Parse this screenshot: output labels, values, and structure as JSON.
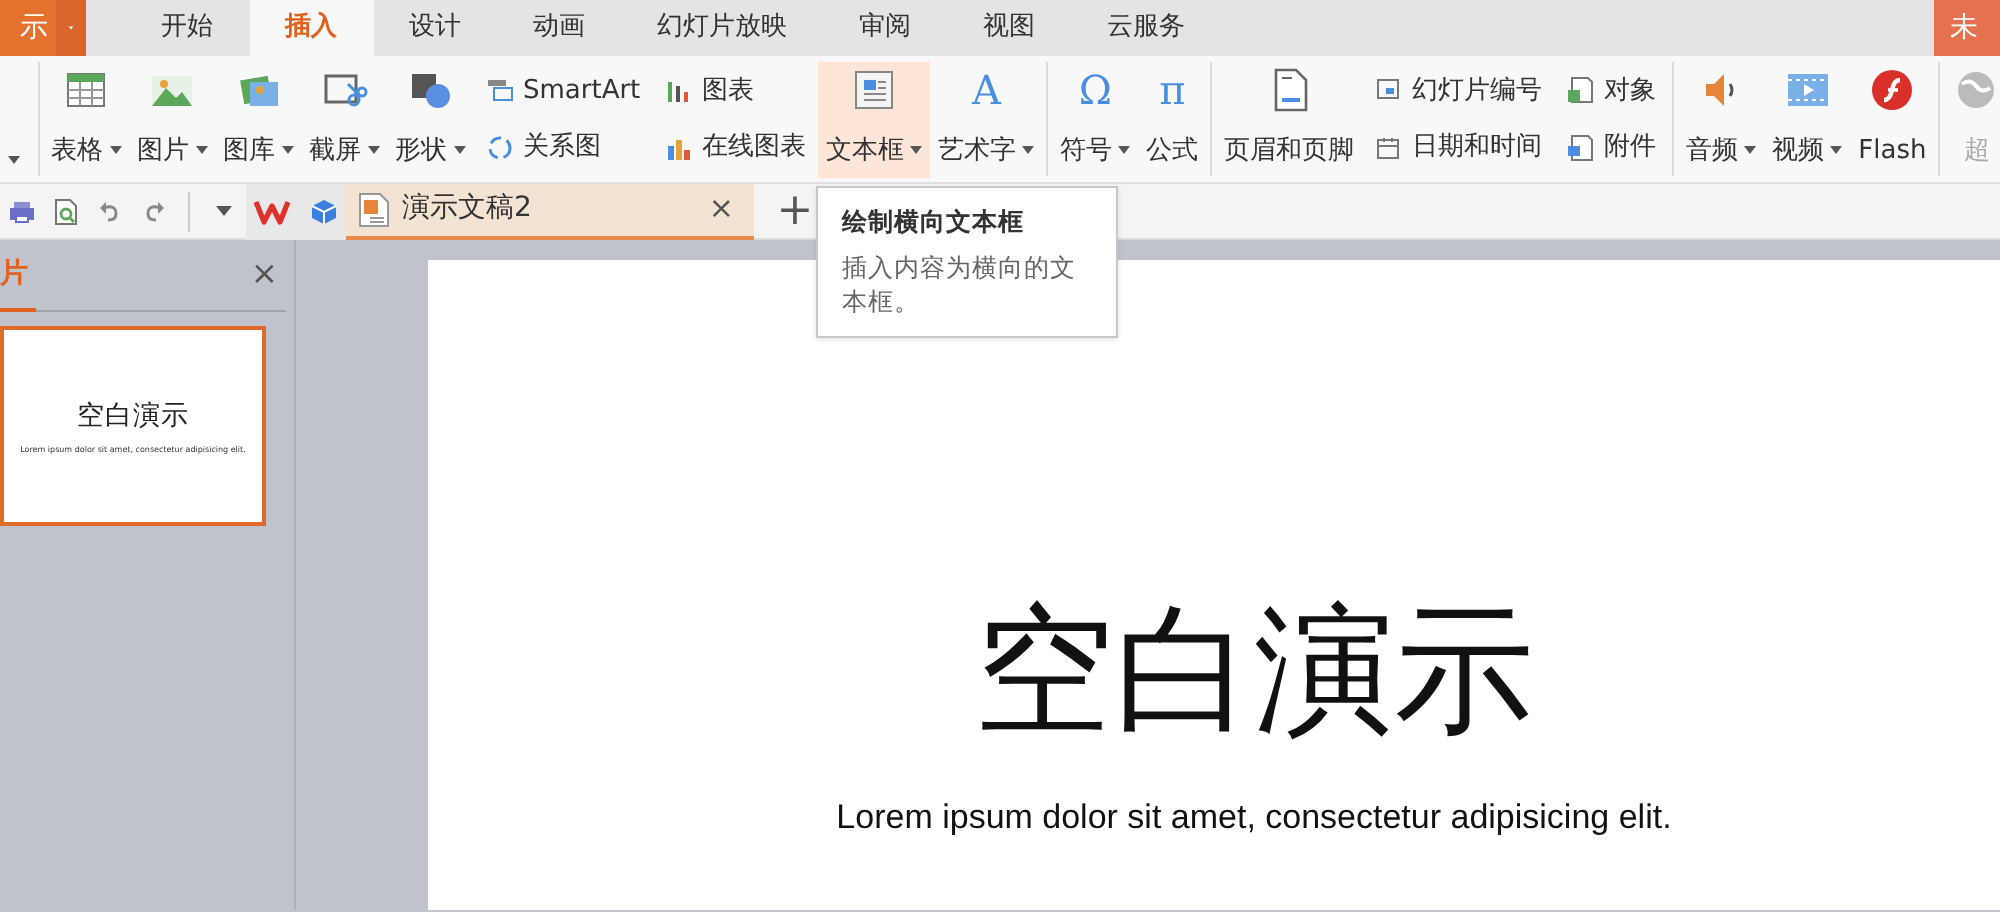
{
  "app_button": {
    "label": "示"
  },
  "menu_tabs": [
    {
      "label": "开始",
      "selected": false
    },
    {
      "label": "插入",
      "selected": true
    },
    {
      "label": "设计",
      "selected": false
    },
    {
      "label": "动画",
      "selected": false
    },
    {
      "label": "幻灯片放映",
      "selected": false
    },
    {
      "label": "审阅",
      "selected": false
    },
    {
      "label": "视图",
      "selected": false
    },
    {
      "label": "云服务",
      "selected": false
    }
  ],
  "corner_button": {
    "label": "未"
  },
  "ribbon_groups": [
    {
      "items": [
        {
          "kind": "large",
          "label": "表格",
          "dropdown": true,
          "highlighted": false,
          "disabled": false
        },
        {
          "kind": "large",
          "label": "图片",
          "dropdown": true,
          "highlighted": false,
          "disabled": false
        },
        {
          "kind": "large",
          "label": "图库",
          "dropdown": true,
          "highlighted": false,
          "disabled": false
        },
        {
          "kind": "large",
          "label": "截屏",
          "dropdown": true,
          "highlighted": false,
          "disabled": false
        },
        {
          "kind": "large",
          "label": "形状",
          "dropdown": true,
          "highlighted": false,
          "disabled": false
        },
        {
          "kind": "stack",
          "rows": [
            {
              "label": "SmartArt"
            },
            {
              "label": "关系图"
            }
          ]
        },
        {
          "kind": "stack",
          "rows": [
            {
              "label": "图表"
            },
            {
              "label": "在线图表"
            }
          ]
        },
        {
          "kind": "large",
          "label": "文本框",
          "dropdown": true,
          "highlighted": true,
          "disabled": false
        },
        {
          "kind": "large",
          "glyph": "A",
          "label": "艺术字",
          "dropdown": true,
          "highlighted": false,
          "disabled": false
        }
      ]
    },
    {
      "items": [
        {
          "kind": "large",
          "glyph": "Ω",
          "label": "符号",
          "dropdown": true,
          "highlighted": false,
          "disabled": false
        },
        {
          "kind": "large",
          "glyph": "π",
          "label": "公式",
          "dropdown": false,
          "highlighted": false,
          "disabled": false
        }
      ]
    },
    {
      "items": [
        {
          "kind": "large",
          "label": "页眉和页脚",
          "dropdown": false,
          "highlighted": false,
          "disabled": false
        },
        {
          "kind": "stack",
          "rows": [
            {
              "label": "幻灯片编号"
            },
            {
              "label": "日期和时间"
            }
          ]
        },
        {
          "kind": "stack",
          "rows": [
            {
              "label": "对象"
            },
            {
              "label": "附件"
            }
          ]
        }
      ]
    },
    {
      "items": [
        {
          "kind": "large",
          "label": "音频",
          "dropdown": true,
          "highlighted": false,
          "disabled": false
        },
        {
          "kind": "large",
          "label": "视频",
          "dropdown": true,
          "highlighted": false,
          "disabled": false
        },
        {
          "kind": "large",
          "label": "Flash",
          "dropdown": false,
          "highlighted": false,
          "disabled": false
        }
      ]
    },
    {
      "items": [
        {
          "kind": "large",
          "label": "超",
          "dropdown": false,
          "highlighted": false,
          "disabled": true
        }
      ]
    }
  ],
  "doc_tabs": [
    {
      "title": "演示文稿2",
      "selected": true,
      "close": "×"
    }
  ],
  "new_tab": "+",
  "tooltip": {
    "title": "绘制横向文本框",
    "body": "插入内容为横向的文本框。"
  },
  "slide_panel": {
    "title": "片",
    "close": "×",
    "thumbnails": [
      {
        "title": "空白演示",
        "subtitle": "Lorem ipsum dolor sit amet, consectetur adipisicing elit.",
        "selected": true
      }
    ]
  },
  "slide": {
    "title": "空白演示",
    "subtitle": "Lorem ipsum dolor sit amet, consectetur adipisicing elit."
  }
}
